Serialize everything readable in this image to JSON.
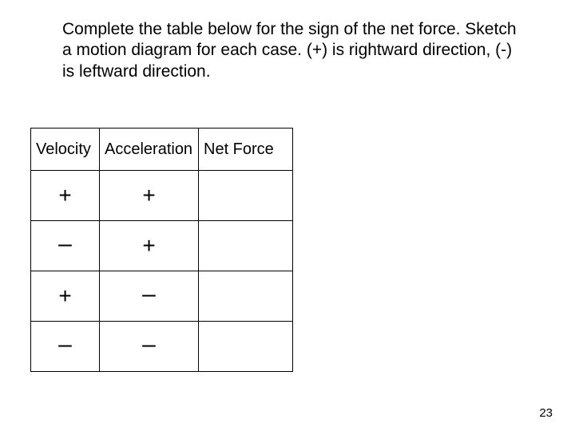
{
  "instructions": "Complete the table below for the sign of the net force. Sketch a motion diagram for each case. (+) is rightward direction, (-) is leftward direction.",
  "table": {
    "headers": {
      "velocity": "Velocity",
      "acceleration": "Acceleration",
      "netforce": "Net Force"
    },
    "rows": [
      {
        "velocity": "+",
        "acceleration": "+",
        "netforce": ""
      },
      {
        "velocity": "–",
        "acceleration": "+",
        "netforce": ""
      },
      {
        "velocity": "+",
        "acceleration": "–",
        "netforce": ""
      },
      {
        "velocity": "–",
        "acceleration": "–",
        "netforce": ""
      }
    ]
  },
  "page_number": "23",
  "chart_data": {
    "type": "table",
    "title": "Sign of net force given velocity and acceleration signs",
    "columns": [
      "Velocity",
      "Acceleration",
      "Net Force"
    ],
    "rows": [
      [
        "+",
        "+",
        ""
      ],
      [
        "–",
        "+",
        ""
      ],
      [
        "+",
        "–",
        ""
      ],
      [
        "–",
        "–",
        ""
      ]
    ]
  }
}
